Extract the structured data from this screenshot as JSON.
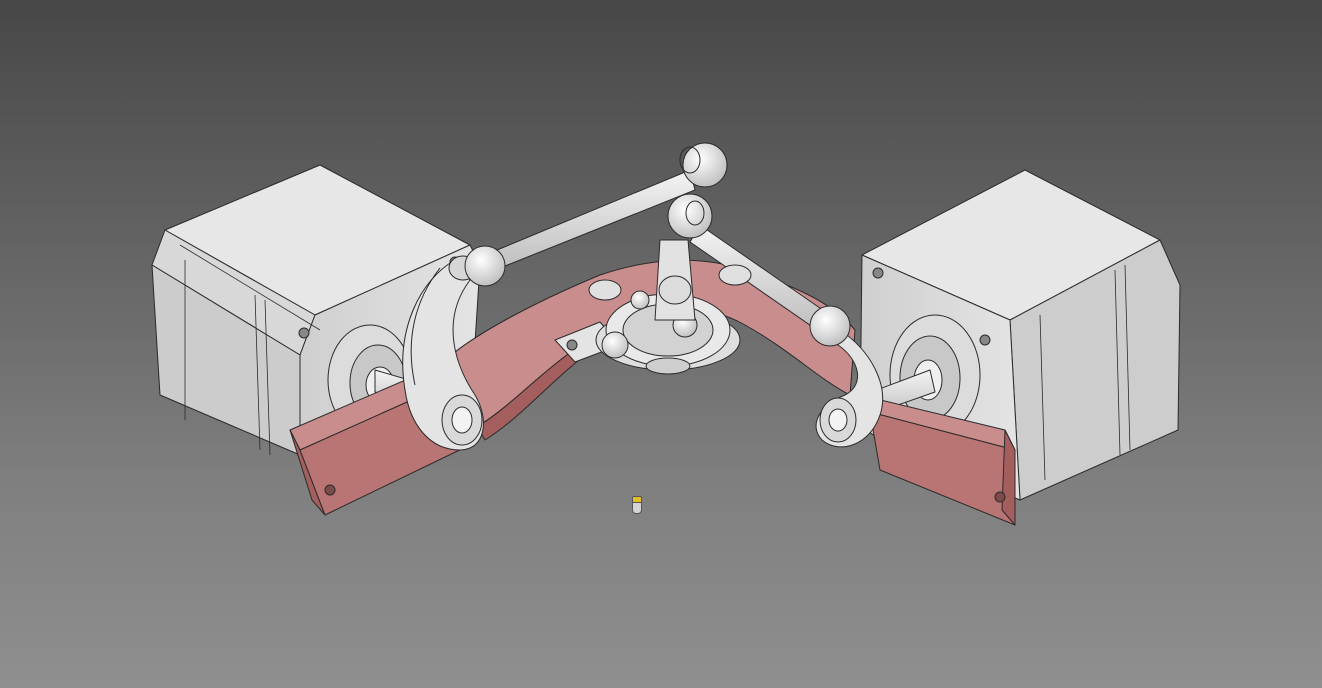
{
  "window": {
    "kind": "cad-3d-viewport",
    "background_top": "#474747",
    "background_bottom": "#8f8f8f"
  },
  "model": {
    "colors": {
      "motor_light": "#e6e6e6",
      "motor_mid": "#d0d0d0",
      "motor_dark": "#bdbdbd",
      "bracket_face": "#b97474",
      "bracket_top": "#c98d8d",
      "bracket_side": "#a45e5e",
      "metal": "#e9e9e9",
      "edge": "#2b2b2b"
    },
    "parts": [
      "stepper-motor",
      "stepper-motor",
      "base-bracket",
      "crank-arm",
      "crank-arm",
      "rod",
      "rod",
      "ball-joint",
      "gimbal-ring"
    ]
  },
  "origin_indicator": {
    "icon": "coordinate-origin-icon",
    "color": "#e0c020"
  }
}
